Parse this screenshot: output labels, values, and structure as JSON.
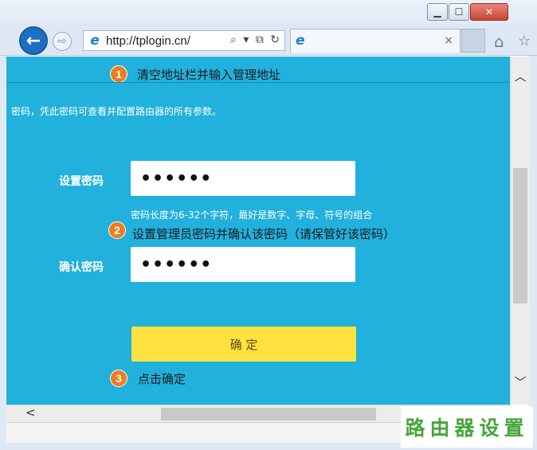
{
  "window": {
    "controls": {
      "minimize": "▁",
      "maximize": "☐",
      "close": "✕"
    }
  },
  "toolbar": {
    "back_icon": "←",
    "forward_icon": "⇨",
    "address_icon": "e",
    "address_url": "http://tplogin.cn/",
    "address_tools": "⌕ ▾ ⧉ ↻",
    "tab_icon": "e",
    "tab_close": "×",
    "home_icon": "⌂",
    "star_icon": "☆"
  },
  "page": {
    "intro": "密码，凭此密码可查看并配置路由器的所有参数。",
    "password_label": "设置密码",
    "password_value": "••••••",
    "hint": "密码长度为6-32个字符，最好是数字、字母、符号的组合",
    "confirm_label": "确认密码",
    "confirm_value": "••••••",
    "submit_label": "确 定"
  },
  "steps": [
    {
      "number": "1",
      "text": "清空地址栏并输入管理地址"
    },
    {
      "number": "2",
      "text": "设置管理员密码并确认该密码（请保管好该密码）"
    },
    {
      "number": "3",
      "text": "点击确定"
    }
  ],
  "scrollbars": {
    "up": "︿",
    "down": "﹀",
    "left": "<"
  },
  "watermark": "路由器设置",
  "colors": {
    "content_bg": "#22b0dc",
    "confirm_button": "#ffe140",
    "step_badge": "#f07c1f",
    "watermark": "#46a63a"
  }
}
